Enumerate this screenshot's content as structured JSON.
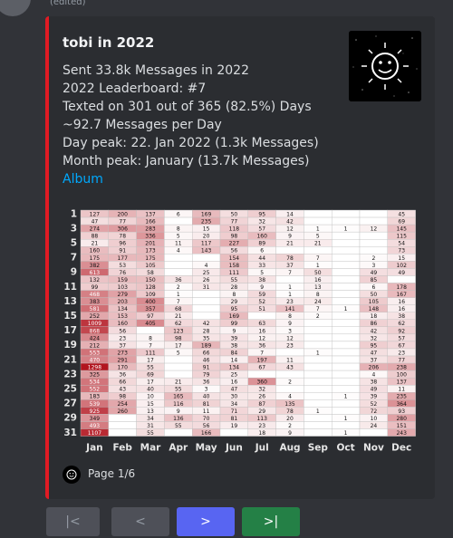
{
  "message": {
    "edited_label": "(edited)"
  },
  "embed": {
    "accent_color": "#e01b24",
    "title": "tobi in 2022",
    "lines": [
      "Sent 33.8k Messages in 2022",
      "2022 Leaderboard: #7",
      "Texted on 301 out of 365 (82.5%) Days",
      "~92.7 Messages per Day",
      "Day peak: 22. Jan 2022 (1.3k Messages)",
      "Month peak: January (13.7k Messages)"
    ],
    "album_link": "Album",
    "thumbnail_icon": "sun-face-icon",
    "footer_icon": "sun-face-icon",
    "footer_text": "Page 1/6"
  },
  "buttons": {
    "first": "|<",
    "prev": "<",
    "next": ">",
    "last": ">|"
  },
  "chart_data": {
    "type": "heatmap",
    "title": "",
    "xlabel": "",
    "ylabel": "",
    "columns": [
      "Jan",
      "Feb",
      "Mar",
      "Apr",
      "May",
      "Jun",
      "Jul",
      "Aug",
      "Sep",
      "Oct",
      "Nov",
      "Dec"
    ],
    "row_tick_labels": [
      "1",
      "3",
      "5",
      "7",
      "9",
      "11",
      "13",
      "15",
      "17",
      "19",
      "21",
      "23",
      "25",
      "27",
      "29",
      "31"
    ],
    "rows": [
      [
        "127",
        "200",
        "137",
        "6",
        "169",
        "50",
        "95",
        "14",
        "",
        "",
        "",
        "45"
      ],
      [
        "47",
        "77",
        "166",
        "",
        "235",
        "77",
        "32",
        "42",
        "",
        "",
        "",
        "69"
      ],
      [
        "274",
        "306",
        "283",
        "8",
        "15",
        "118",
        "57",
        "12",
        "1",
        "1",
        "12",
        "145"
      ],
      [
        "88",
        "78",
        "336",
        "5",
        "20",
        "98",
        "160",
        "9",
        "5",
        "",
        "",
        "115"
      ],
      [
        "21",
        "96",
        "201",
        "11",
        "117",
        "227",
        "89",
        "21",
        "21",
        "",
        "",
        "54"
      ],
      [
        "160",
        "91",
        "173",
        "4",
        "143",
        "56",
        "6",
        "",
        "",
        "",
        "",
        "73"
      ],
      [
        "175",
        "177",
        "175",
        "",
        "",
        "154",
        "44",
        "78",
        "7",
        "",
        "2",
        "15"
      ],
      [
        "382",
        "53",
        "105",
        "",
        "4",
        "158",
        "33",
        "37",
        "1",
        "",
        "3",
        "102"
      ],
      [
        "613",
        "76",
        "58",
        "",
        "25",
        "111",
        "5",
        "7",
        "50",
        "",
        "49",
        "49"
      ],
      [
        "132",
        "159",
        "150",
        "36",
        "26",
        "55",
        "38",
        "",
        "16",
        "",
        "85",
        ""
      ],
      [
        "99",
        "103",
        "128",
        "2",
        "31",
        "28",
        "9",
        "1",
        "13",
        "",
        "6",
        "178"
      ],
      [
        "468",
        "279",
        "109",
        "1",
        "",
        "8",
        "59",
        "1",
        "8",
        "",
        "50",
        "167"
      ],
      [
        "383",
        "203",
        "400",
        "7",
        "",
        "29",
        "52",
        "23",
        "24",
        "",
        "105",
        "16"
      ],
      [
        "581",
        "134",
        "357",
        "68",
        "",
        "95",
        "51",
        "141",
        "7",
        "1",
        "148",
        "16"
      ],
      [
        "252",
        "153",
        "97",
        "21",
        "",
        "169",
        "",
        "8",
        "2",
        "",
        "18",
        "38"
      ],
      [
        "1009",
        "160",
        "405",
        "62",
        "42",
        "99",
        "63",
        "9",
        "",
        "",
        "86",
        "62"
      ],
      [
        "868",
        "56",
        "",
        "123",
        "28",
        "9",
        "16",
        "3",
        "",
        "",
        "42",
        "92"
      ],
      [
        "424",
        "23",
        "8",
        "98",
        "35",
        "39",
        "12",
        "12",
        "",
        "",
        "32",
        "57"
      ],
      [
        "212",
        "37",
        "7",
        "17",
        "189",
        "38",
        "36",
        "23",
        "",
        "",
        "95",
        "67"
      ],
      [
        "553",
        "273",
        "111",
        "5",
        "66",
        "84",
        "7",
        "",
        "1",
        "",
        "47",
        "23"
      ],
      [
        "470",
        "291",
        "17",
        "",
        "46",
        "14",
        "197",
        "11",
        "",
        "",
        "37",
        "77"
      ],
      [
        "1298",
        "170",
        "55",
        "",
        "91",
        "134",
        "67",
        "43",
        "",
        "",
        "206",
        "238"
      ],
      [
        "325",
        "36",
        "69",
        "",
        "79",
        "25",
        "",
        "",
        "",
        "",
        "4",
        "100"
      ],
      [
        "534",
        "66",
        "17",
        "21",
        "36",
        "16",
        "360",
        "2",
        "",
        "",
        "38",
        "137"
      ],
      [
        "552",
        "43",
        "40",
        "55",
        "3",
        "47",
        "32",
        "",
        "",
        "",
        "49",
        "11"
      ],
      [
        "183",
        "98",
        "10",
        "165",
        "40",
        "30",
        "26",
        "4",
        "",
        "1",
        "39",
        "235"
      ],
      [
        "539",
        "254",
        "15",
        "116",
        "81",
        "34",
        "87",
        "135",
        "",
        "",
        "52",
        "364"
      ],
      [
        "925",
        "260",
        "13",
        "9",
        "11",
        "71",
        "29",
        "78",
        "1",
        "",
        "72",
        "93"
      ],
      [
        "349",
        "",
        "34",
        "136",
        "70",
        "81",
        "113",
        "20",
        "",
        "1",
        "10",
        "280"
      ],
      [
        "493",
        "",
        "31",
        "55",
        "56",
        "19",
        "23",
        "2",
        "",
        "",
        "24",
        "151"
      ],
      [
        "1107",
        "",
        "55",
        "",
        "166",
        "",
        "18",
        "9",
        "",
        "1",
        "",
        "243"
      ]
    ]
  }
}
